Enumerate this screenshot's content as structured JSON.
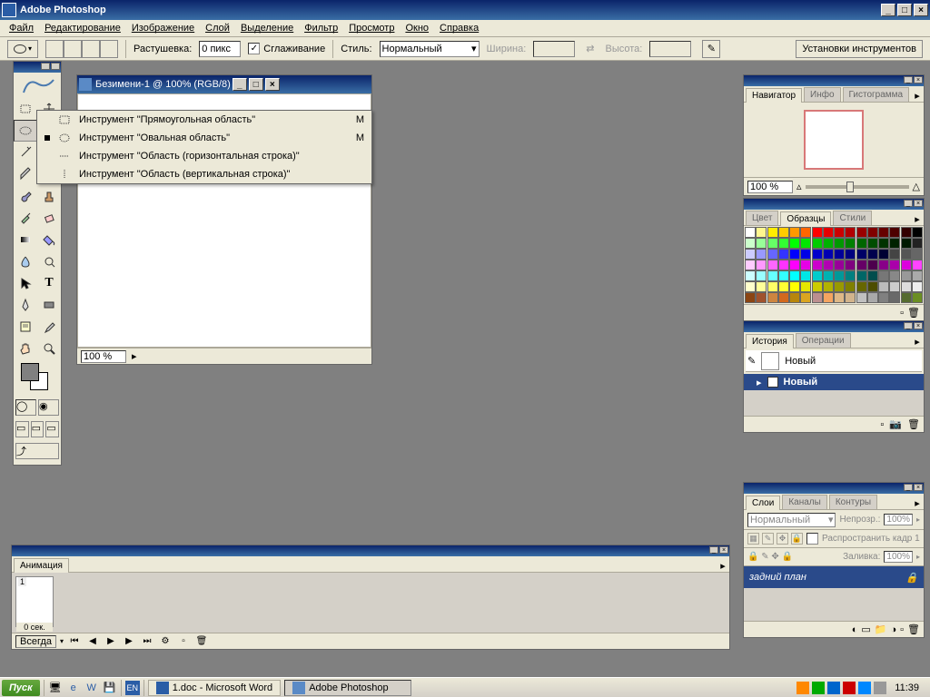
{
  "app": {
    "title": "Adobe Photoshop"
  },
  "menubar": [
    "Файл",
    "Редактирование",
    "Изображение",
    "Слой",
    "Выделение",
    "Фильтр",
    "Просмотр",
    "Окно",
    "Справка"
  ],
  "options": {
    "feather_label": "Растушевка:",
    "feather_value": "0 пикс",
    "antialias_label": "Сглаживание",
    "style_label": "Стиль:",
    "style_value": "Нормальный",
    "width_label": "Ширина:",
    "height_label": "Высота:",
    "settings_label": "Установки инструментов"
  },
  "document": {
    "title": "Безимени-1 @ 100% (RGB/8)",
    "zoom": "100 %"
  },
  "flyout": [
    {
      "label": "Инструмент \"Прямоугольная область\"",
      "shortcut": "M",
      "selected": false
    },
    {
      "label": "Инструмент \"Овальная область\"",
      "shortcut": "M",
      "selected": true
    },
    {
      "label": "Инструмент \"Область (горизонтальная строка)\"",
      "shortcut": "",
      "selected": false
    },
    {
      "label": "Инструмент \"Область (вертикальная строка)\"",
      "shortcut": "",
      "selected": false
    }
  ],
  "navigator": {
    "tabs": [
      "Навигатор",
      "Инфо",
      "Гистограмма"
    ],
    "zoom": "100 %"
  },
  "color_panel": {
    "tabs": [
      "Цвет",
      "Образцы",
      "Стили"
    ]
  },
  "swatches": [
    "#ffffff",
    "#fff68f",
    "#ffed00",
    "#ffcc00",
    "#ff9900",
    "#ff6600",
    "#ff0000",
    "#e60000",
    "#cc0000",
    "#b20000",
    "#990000",
    "#800000",
    "#660000",
    "#4d0000",
    "#330000",
    "#000000",
    "#ccffcc",
    "#99ff99",
    "#66ff66",
    "#33ff33",
    "#00ff00",
    "#00e600",
    "#00cc00",
    "#00b200",
    "#009900",
    "#008000",
    "#006600",
    "#004d00",
    "#003300",
    "#002200",
    "#001a00",
    "#222222",
    "#ccccff",
    "#9999ff",
    "#6666ff",
    "#3333ff",
    "#0000ff",
    "#0000e6",
    "#0000cc",
    "#0000b2",
    "#000099",
    "#000080",
    "#000066",
    "#00004d",
    "#000033",
    "#444444",
    "#555555",
    "#666666",
    "#ffccff",
    "#ff99ff",
    "#ff66ff",
    "#ff33ff",
    "#ff00ff",
    "#e600e6",
    "#cc00cc",
    "#b200b2",
    "#990099",
    "#800080",
    "#660066",
    "#4d004d",
    "#880088",
    "#aa00aa",
    "#dd00dd",
    "#ff44ff",
    "#ccffff",
    "#99ffff",
    "#66ffff",
    "#33ffff",
    "#00ffff",
    "#00e6e6",
    "#00cccc",
    "#00b2b2",
    "#009999",
    "#008080",
    "#006666",
    "#004d4d",
    "#777777",
    "#888888",
    "#999999",
    "#aaaaaa",
    "#ffffcc",
    "#ffff99",
    "#ffff66",
    "#ffff33",
    "#ffff00",
    "#e6e600",
    "#cccc00",
    "#b2b200",
    "#999900",
    "#808000",
    "#666600",
    "#4d4d00",
    "#bbbbbb",
    "#cccccc",
    "#dddddd",
    "#eeeeee",
    "#8b4513",
    "#a0522d",
    "#cd853f",
    "#d2691e",
    "#b8860b",
    "#daa520",
    "#bc8f8f",
    "#f4a460",
    "#deb887",
    "#d2b48c",
    "#c0c0c0",
    "#a9a9a9",
    "#808080",
    "#696969",
    "#556b2f",
    "#6b8e23"
  ],
  "history": {
    "tabs": [
      "История",
      "Операции"
    ],
    "doc_name": "Новый",
    "item": "Новый"
  },
  "layers": {
    "tabs": [
      "Слои",
      "Каналы",
      "Контуры"
    ],
    "blend_mode": "Нормальный",
    "opacity_label": "Непрозр.:",
    "opacity_value": "100%",
    "propagate_label": "Распространить кадр 1",
    "fill_label": "Заливка:",
    "fill_value": "100%",
    "layer_name": "задний план"
  },
  "animation": {
    "tab": "Анимация",
    "frame_duration": "0 сек.",
    "loop_label": "Всегда"
  },
  "taskbar": {
    "start": "Пуск",
    "task1": "1.doc - Microsoft Word",
    "task2": "Adobe Photoshop",
    "lang": "EN",
    "clock": "11:39"
  }
}
